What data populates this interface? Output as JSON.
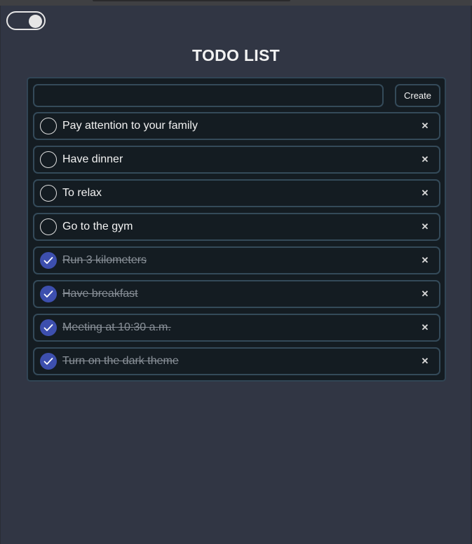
{
  "header": {
    "title": "TODO LIST"
  },
  "theme_toggle": {
    "state": "on"
  },
  "composer": {
    "input_value": "",
    "placeholder": "",
    "create_label": "Create"
  },
  "todos": [
    {
      "text": "Pay attention to your family",
      "done": false
    },
    {
      "text": "Have dinner",
      "done": false
    },
    {
      "text": "To relax",
      "done": false
    },
    {
      "text": "Go to the gym",
      "done": false
    },
    {
      "text": "Run 3 kilometers",
      "done": true
    },
    {
      "text": "Have breakfast",
      "done": true
    },
    {
      "text": "Meeting at 10:30 a.m.",
      "done": true
    },
    {
      "text": "Turn on the dark theme",
      "done": true
    }
  ],
  "icons": {
    "delete": "close-icon",
    "check": "checkmark-icon"
  },
  "delete_glyph": "✕",
  "colors": {
    "background": "#313644",
    "panel": "#141c22",
    "border": "#344a59",
    "check_fill": "#3d4fae",
    "done_text": "#8a9199"
  }
}
